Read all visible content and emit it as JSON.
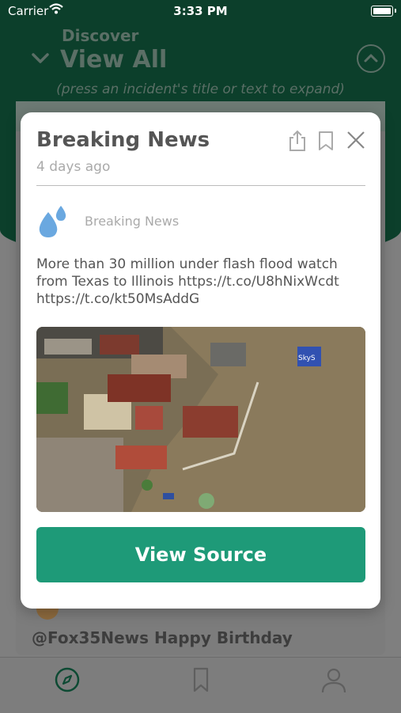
{
  "status_bar": {
    "carrier": "Carrier",
    "time": "3:33 PM"
  },
  "background": {
    "section_label": "Discover",
    "title": "View All",
    "hint": "(press an incident's title or text to expand)",
    "tweet_preview": "@Fox35News Happy Birthday"
  },
  "modal": {
    "title": "Breaking News",
    "time_ago": "4 days ago",
    "source_label": "Breaking News",
    "body": "More than 30 million under flash flood watch from Texas to Illinois https://t.co/U8hNixWcdt https://t.co/kt50MsAddG",
    "image_overlay": "SkyS",
    "button_label": "View Source"
  },
  "tabbar": {
    "items": [
      "compass-icon",
      "bookmark-icon",
      "profile-icon"
    ]
  },
  "colors": {
    "primary": "#1e9a78",
    "header_green": "#0c3f2b",
    "water_drop": "#6aa8e0"
  }
}
